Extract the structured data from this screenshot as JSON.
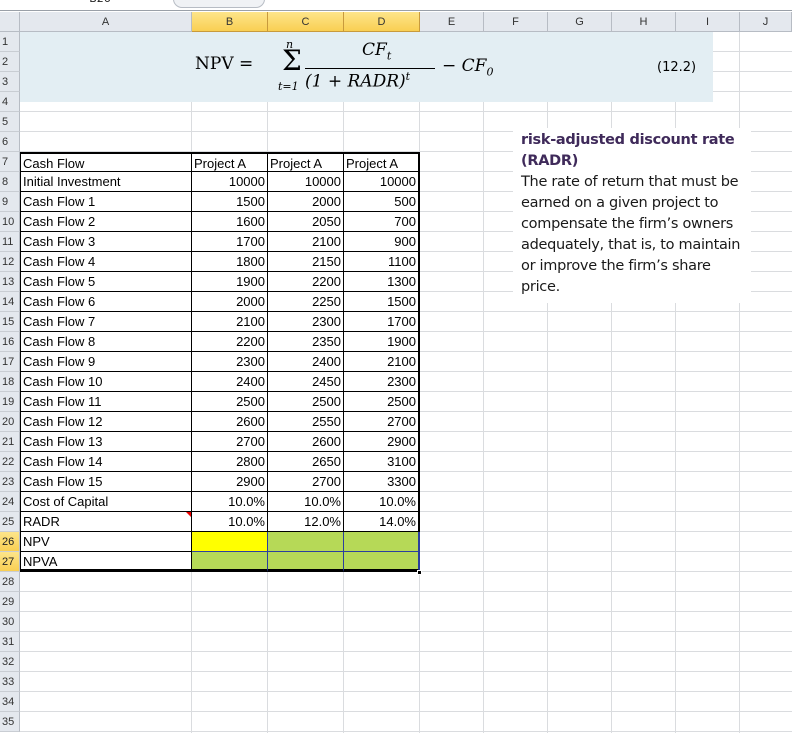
{
  "name_box": "B26",
  "columns": [
    "A",
    "B",
    "C",
    "D",
    "E",
    "F",
    "G",
    "H",
    "I",
    "J"
  ],
  "selected_columns": [
    "B",
    "C",
    "D"
  ],
  "rows": [
    "1",
    "2",
    "3",
    "4",
    "5",
    "6",
    "7",
    "8",
    "9",
    "10",
    "11",
    "12",
    "13",
    "14",
    "15",
    "16",
    "17",
    "18",
    "19",
    "20",
    "21",
    "22",
    "23",
    "24",
    "25",
    "26",
    "27",
    "28",
    "29",
    "30",
    "31",
    "32",
    "33",
    "34",
    "35"
  ],
  "selected_rows": [
    "26",
    "27"
  ],
  "formula": {
    "lhs": "NPV",
    "sum_upper": "n",
    "sum_lower": "t=1",
    "numerator": "CF",
    "numerator_sub": "t",
    "denominator": "(1 + RADR)",
    "denominator_sup": "t",
    "minus": "− CF",
    "minus_sub": "0",
    "equation_number": "(12.2)"
  },
  "table": {
    "headers": [
      "Cash Flow",
      "Project A",
      "Project A",
      "Project A"
    ],
    "rows": [
      [
        "Initial Investment",
        "10000",
        "10000",
        "10000"
      ],
      [
        "Cash Flow 1",
        "1500",
        "2000",
        "500"
      ],
      [
        "Cash Flow 2",
        "1600",
        "2050",
        "700"
      ],
      [
        "Cash Flow 3",
        "1700",
        "2100",
        "900"
      ],
      [
        "Cash Flow 4",
        "1800",
        "2150",
        "1100"
      ],
      [
        "Cash Flow 5",
        "1900",
        "2200",
        "1300"
      ],
      [
        "Cash Flow 6",
        "2000",
        "2250",
        "1500"
      ],
      [
        "Cash Flow 7",
        "2100",
        "2300",
        "1700"
      ],
      [
        "Cash Flow 8",
        "2200",
        "2350",
        "1900"
      ],
      [
        "Cash Flow 9",
        "2300",
        "2400",
        "2100"
      ],
      [
        "Cash Flow 10",
        "2400",
        "2450",
        "2300"
      ],
      [
        "Cash Flow 11",
        "2500",
        "2500",
        "2500"
      ],
      [
        "Cash Flow 12",
        "2600",
        "2550",
        "2700"
      ],
      [
        "Cash Flow 13",
        "2700",
        "2600",
        "2900"
      ],
      [
        "Cash Flow 14",
        "2800",
        "2650",
        "3100"
      ],
      [
        "Cash Flow 15",
        "2900",
        "2700",
        "3300"
      ],
      [
        "Cost of Capital",
        "10.0%",
        "10.0%",
        "10.0%"
      ],
      [
        "RADR",
        "10.0%",
        "12.0%",
        "14.0%"
      ],
      [
        "NPV",
        "",
        "",
        ""
      ],
      [
        "NPVA",
        "",
        "",
        ""
      ]
    ]
  },
  "definition": {
    "term": "risk-adjusted discount rate (RADR)",
    "text": "The rate of return that must be earned on a given project to compensate the firm’s owners adequately, that is, to maintain or improve the firm’s share price."
  },
  "colors": {
    "active_cell": "#ffff00",
    "selection_fill": "#b6d957",
    "header_selected": "#f9cf53",
    "formula_bg": "#e3eef3",
    "term": "#3f2a5a"
  }
}
